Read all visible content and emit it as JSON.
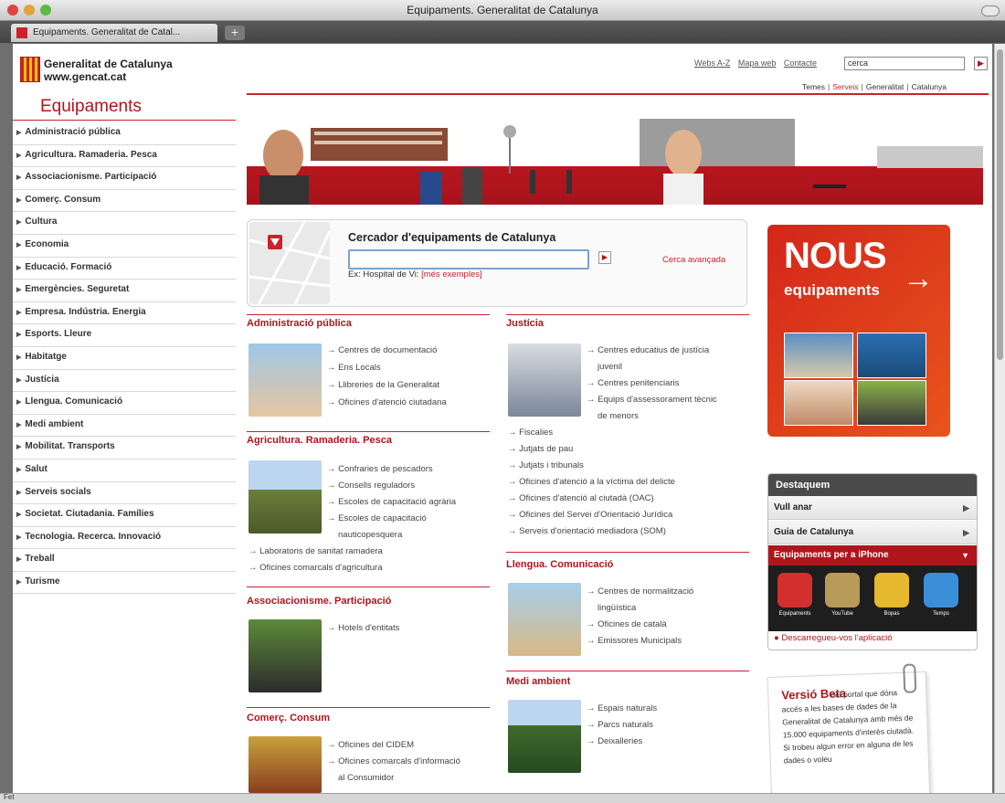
{
  "browser": {
    "window_title": "Equipaments. Generalitat de Catalunya",
    "tab_label": "Equipaments. Generalitat de Catal...",
    "new_tab_label": "+",
    "status_text": "Fet"
  },
  "header": {
    "logo_line1": "Generalitat de Catalunya",
    "logo_line2": "www.gencat.cat",
    "top_links": [
      "Webs A-Z",
      "Mapa web",
      "Contacte"
    ],
    "search_value": "cerca",
    "search_button": "▶",
    "subnav": [
      {
        "label": "Temes",
        "active": false
      },
      {
        "label": "Serveis",
        "active": true
      },
      {
        "label": "Generalitat",
        "active": false
      },
      {
        "label": "Catalunya",
        "active": false
      }
    ]
  },
  "sidebar": {
    "title": "Equipaments",
    "items": [
      "Administració pública",
      "Agricultura. Ramaderia. Pesca",
      "Associacionisme. Participació",
      "Comerç. Consum",
      "Cultura",
      "Economia",
      "Educació. Formació",
      "Emergències. Seguretat",
      "Empresa. Indústria. Energia",
      "Esports. Lleure",
      "Habitatge",
      "Justícia",
      "Llengua. Comunicació",
      "Medi ambient",
      "Mobilitat. Transports",
      "Salut",
      "Serveis socials",
      "Societat. Ciutadania. Famílies",
      "Tecnologia. Recerca. Innovació",
      "Treball",
      "Turisme"
    ]
  },
  "search": {
    "title": "Cercador d'equipaments de Catalunya",
    "input_value": "",
    "button": "▶",
    "advanced": "Cerca avançada",
    "example": "Ex: Hospital de Vi:",
    "more_examples": "[més exemples]"
  },
  "categories": {
    "admin": {
      "title": "Administració pública",
      "links": [
        "Centres de documentació",
        "Ens Locals",
        "Llibreries de la Generalitat",
        "Oficines d'atenció ciutadana"
      ]
    },
    "agri": {
      "title": "Agricultura. Ramaderia. Pesca",
      "links": [
        "Confraries de pescadors",
        "Consells reguladors",
        "Escoles de capacitació agrària",
        "Escoles de capacitació",
        "nauticopesquera",
        "Laboratoris de sanitat ramadera",
        "Oficines comarcals d'agricultura"
      ]
    },
    "assoc": {
      "title": "Associacionisme. Participació",
      "links": [
        "Hotels d'entitats"
      ]
    },
    "comerc": {
      "title": "Comerç. Consum",
      "links": [
        "Oficines del CIDEM",
        "Oficines comarcals d'informació",
        "al Consumidor"
      ]
    },
    "justicia": {
      "title": "Justícia",
      "links": [
        "Centres educatius de justícia",
        "juvenil",
        "Centres penitenciaris",
        "Equips d'assessorament tècnic",
        "de menors",
        "Fiscalies",
        "Jutjats de pau",
        "Jutjats i tribunals",
        "Oficines d'atenció a la víctima del delicte",
        "Oficines d'atenció al ciutadà (OAC)",
        "Oficines del Servei d'Orientació Jurídica",
        "Serveis d'orientació mediadora (SOM)"
      ]
    },
    "llengua": {
      "title": "Llengua. Comunicació",
      "links": [
        "Centres de normalització",
        "lingüística",
        "Oficines de català",
        "Emissores Municipals"
      ]
    },
    "medi": {
      "title": "Medi ambient",
      "links": [
        "Espais naturals",
        "Parcs naturals",
        "Deixalleries"
      ]
    }
  },
  "promo": {
    "nous": "NOUS",
    "equipaments": "equipaments",
    "arrow": "→"
  },
  "destaquem": {
    "title": "Destaquem",
    "rows": [
      "Vull anar",
      "Guia de Catalunya"
    ],
    "iphone": "Equipaments per a iPhone",
    "apps": [
      "Equipaments",
      "YouTube",
      "Bopas",
      "Temps"
    ],
    "download": "Descarregueu-vos l'aplicació"
  },
  "beta": {
    "title": "Versió Beta",
    "text": "del portal que dóna accés a les bases de dades de la Generalitat de Catalunya amb més de 15.000 equipaments d'interès ciutadà. Si trobeu algun error en alguna de les dades o voleu"
  },
  "colors": {
    "accent": "#b0151c",
    "accent_bright": "#c8242b",
    "promo_orange": "#e9541b",
    "dark_panel": "#4a4a4a"
  }
}
